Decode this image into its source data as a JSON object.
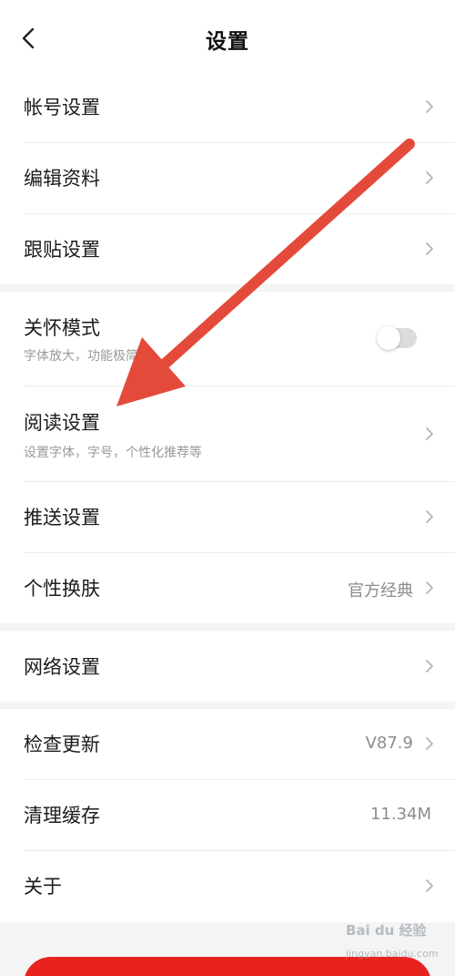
{
  "header": {
    "title": "设置",
    "back_icon": "chevron-left-icon"
  },
  "items": {
    "account": {
      "label": "帐号设置"
    },
    "profile": {
      "label": "编辑资料"
    },
    "follow_post": {
      "label": "跟贴设置"
    },
    "care_mode": {
      "label": "关怀模式",
      "subtitle": "字体放大，功能极简",
      "enabled": false
    },
    "reading": {
      "label": "阅读设置",
      "subtitle": "设置字体，字号，个性化推荐等"
    },
    "push": {
      "label": "推送设置"
    },
    "skin": {
      "label": "个性换肤",
      "value": "官方经典"
    },
    "network": {
      "label": "网络设置"
    },
    "update": {
      "label": "检查更新",
      "value": "V87.9"
    },
    "cache": {
      "label": "清理缓存",
      "value": "11.34M"
    },
    "about": {
      "label": "关于"
    }
  },
  "watermark": {
    "brand": "Bai du 经验",
    "url": "jingyan.baidu.com"
  },
  "colors": {
    "accent_red": "#e8231e",
    "annotation_arrow": "#e44a3a",
    "toggle_off": "#dcdcdc"
  }
}
